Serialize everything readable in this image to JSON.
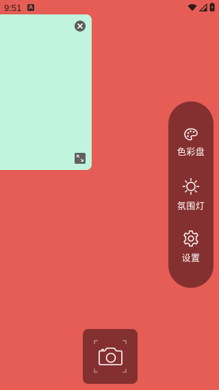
{
  "status_bar": {
    "time": "9:51",
    "notification_icon": "A"
  },
  "preview": {
    "close_icon": "close-circle-icon",
    "expand_icon": "expand-icon"
  },
  "side_menu": {
    "items": [
      {
        "label": "色彩盘",
        "icon": "palette-icon"
      },
      {
        "label": "氛围灯",
        "icon": "sun-icon"
      },
      {
        "label": "设置",
        "icon": "gear-icon"
      }
    ]
  },
  "camera": {
    "icon": "camera-icon"
  },
  "colors": {
    "background": "#E55D55",
    "preview": "#C1F4DD",
    "menu": "#853030"
  }
}
